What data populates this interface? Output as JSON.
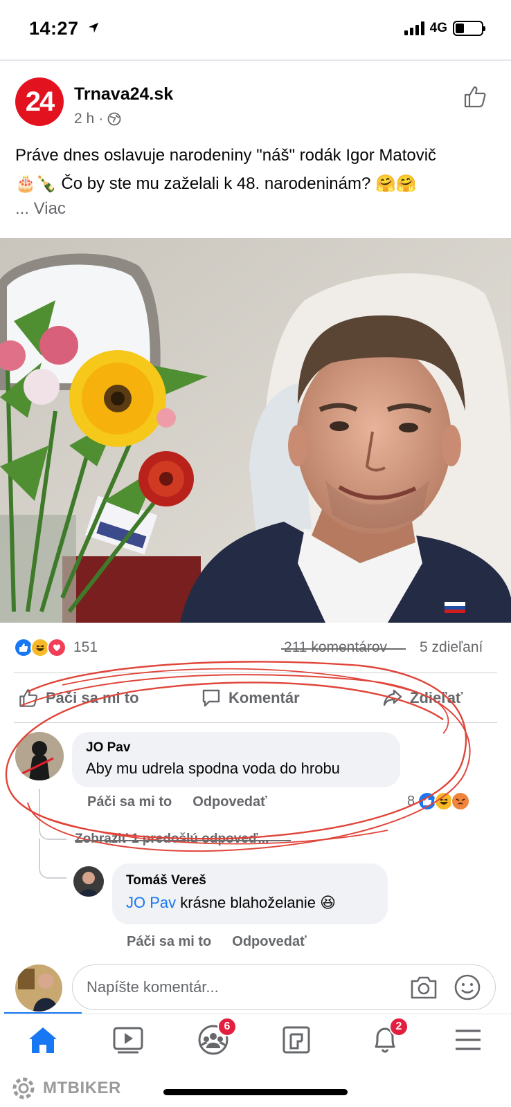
{
  "status_bar": {
    "time": "14:27",
    "network": "4G"
  },
  "post": {
    "logo_text": "24",
    "page_name": "Trnava24.sk",
    "time_ago": "2 h",
    "dot": "·",
    "text_line1": "Práve dnes oslavuje narodeniny \"náš\" rodák Igor Matovič",
    "text_line2": "🎂🍾 Čo by ste mu zaželali k 48. narodeninám? 🤗🤗",
    "more": "... Viac"
  },
  "engagement": {
    "reactions_count": "151",
    "comments": "211 komentárov",
    "shares": "5 zdieľaní"
  },
  "actions": {
    "like": "Páči sa mi to",
    "comment": "Komentár",
    "share": "Zdieľať"
  },
  "comments": [
    {
      "author": "JO Pav",
      "text": "Aby mu udrela spodna voda do hrobu",
      "like": "Páči sa mi to",
      "reply": "Odpovedať",
      "reactions_count": "8"
    }
  ],
  "view_previous": "Zobraziť 1 predošlú odpoveď...",
  "reply": {
    "author": "Tomáš Vereš",
    "mention": "JO Pav",
    "text": " krásne blahoželanie 😆",
    "like": "Páči sa mi to",
    "reply": "Odpovedať"
  },
  "composer": {
    "placeholder": "Napíšte komentár..."
  },
  "nav": {
    "groups_badge": "6",
    "notifications_badge": "2"
  },
  "watermark": "MTBIKER",
  "colors": {
    "fb_blue": "#1877f2",
    "brand_red": "#e2121f",
    "ink_red": "#e0453a"
  }
}
